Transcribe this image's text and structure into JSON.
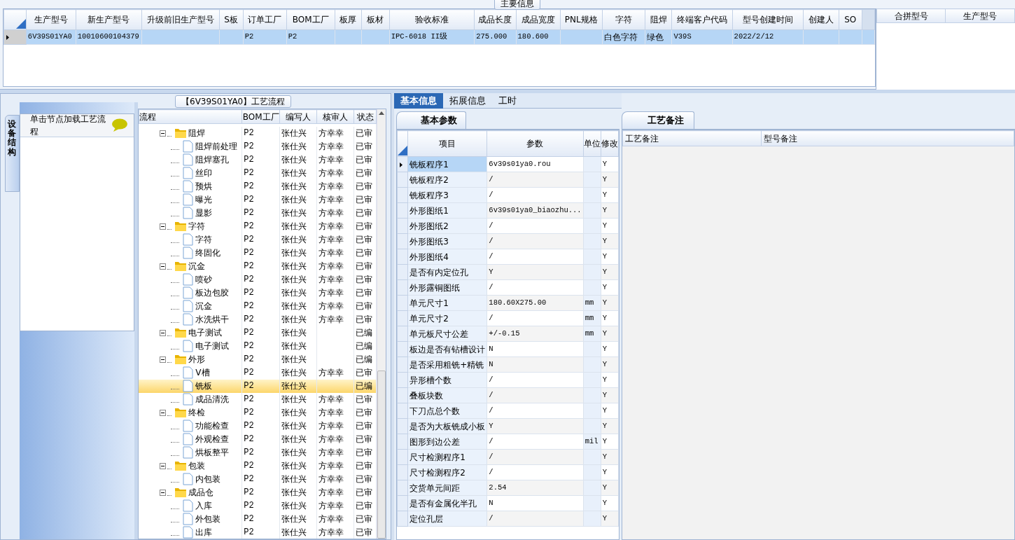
{
  "main_info": {
    "title": "主要信息",
    "columns": [
      "生产型号",
      "新生产型号",
      "升级前旧生产型号",
      "S板",
      "订单工厂",
      "BOM工厂",
      "板厚",
      "板材",
      "验收标准",
      "成品长度",
      "成品宽度",
      "PNL规格",
      "字符",
      "阻焊",
      "终端客户代码",
      "型号创建时间",
      "创建人",
      "SO"
    ],
    "rows": [
      {
        "selected": true,
        "cells": [
          "6V39S01YA0",
          "10010600104379",
          null,
          null,
          "P2",
          "P2",
          null,
          null,
          "IPC-6018 II级",
          "275.000",
          "180.600",
          null,
          "白色字符",
          "绿色",
          "V39S",
          "2022/2/12",
          null,
          null
        ]
      }
    ]
  },
  "merge_grid": {
    "columns": [
      "合拼型号",
      "生产型号"
    ]
  },
  "process_panel": {
    "title": "【6V39S01YA0】工艺流程",
    "side_tab": "设备结构",
    "hint": "单击节点加载工艺流程"
  },
  "tree": {
    "columns": [
      "流程",
      "BOM工厂",
      "编写人",
      "核审人",
      "状态"
    ],
    "nodes": [
      {
        "label": "阻焊",
        "bom": "P2",
        "author": "张仕兴",
        "reviewer": "方幸幸",
        "status": "已审",
        "expanded": true,
        "selected": false,
        "children": [
          {
            "label": "阻焊前处理",
            "bom": "P2",
            "author": "张仕兴",
            "reviewer": "方幸幸",
            "status": "已审",
            "selected": false
          },
          {
            "label": "阻焊塞孔",
            "bom": "P2",
            "author": "张仕兴",
            "reviewer": "方幸幸",
            "status": "已审",
            "selected": false
          },
          {
            "label": "丝印",
            "bom": "P2",
            "author": "张仕兴",
            "reviewer": "方幸幸",
            "status": "已审",
            "selected": false
          },
          {
            "label": "预烘",
            "bom": "P2",
            "author": "张仕兴",
            "reviewer": "方幸幸",
            "status": "已审",
            "selected": false
          },
          {
            "label": "曝光",
            "bom": "P2",
            "author": "张仕兴",
            "reviewer": "方幸幸",
            "status": "已审",
            "selected": false
          },
          {
            "label": "显影",
            "bom": "P2",
            "author": "张仕兴",
            "reviewer": "方幸幸",
            "status": "已审",
            "selected": false
          }
        ]
      },
      {
        "label": "字符",
        "bom": "P2",
        "author": "张仕兴",
        "reviewer": "方幸幸",
        "status": "已审",
        "expanded": true,
        "selected": false,
        "children": [
          {
            "label": "字符",
            "bom": "P2",
            "author": "张仕兴",
            "reviewer": "方幸幸",
            "status": "已审",
            "selected": false
          },
          {
            "label": "终固化",
            "bom": "P2",
            "author": "张仕兴",
            "reviewer": "方幸幸",
            "status": "已审",
            "selected": false
          }
        ]
      },
      {
        "label": "沉金",
        "bom": "P2",
        "author": "张仕兴",
        "reviewer": "方幸幸",
        "status": "已审",
        "expanded": true,
        "selected": false,
        "children": [
          {
            "label": "喷砂",
            "bom": "P2",
            "author": "张仕兴",
            "reviewer": "方幸幸",
            "status": "已审",
            "selected": false
          },
          {
            "label": "板边包胶",
            "bom": "P2",
            "author": "张仕兴",
            "reviewer": "方幸幸",
            "status": "已审",
            "selected": false
          },
          {
            "label": "沉金",
            "bom": "P2",
            "author": "张仕兴",
            "reviewer": "方幸幸",
            "status": "已审",
            "selected": false
          },
          {
            "label": "水洗烘干",
            "bom": "P2",
            "author": "张仕兴",
            "reviewer": "方幸幸",
            "status": "已审",
            "selected": false
          }
        ]
      },
      {
        "label": "电子测试",
        "bom": "P2",
        "author": "张仕兴",
        "status": "已编",
        "expanded": true,
        "selected": false,
        "children": [
          {
            "label": "电子测试",
            "bom": "P2",
            "author": "张仕兴",
            "status": "已编",
            "selected": false
          }
        ]
      },
      {
        "label": "外形",
        "bom": "P2",
        "author": "张仕兴",
        "status": "已编",
        "expanded": true,
        "selected": false,
        "children": [
          {
            "label": "V槽",
            "bom": "P2",
            "author": "张仕兴",
            "reviewer": "方幸幸",
            "status": "已审",
            "selected": false
          },
          {
            "label": "铣板",
            "bom": "P2",
            "author": "张仕兴",
            "status": "已编",
            "selected": true
          },
          {
            "label": "成品清洗",
            "bom": "P2",
            "author": "张仕兴",
            "reviewer": "方幸幸",
            "status": "已审",
            "selected": false
          }
        ]
      },
      {
        "label": "终检",
        "bom": "P2",
        "author": "张仕兴",
        "reviewer": "方幸幸",
        "status": "已审",
        "expanded": true,
        "selected": false,
        "children": [
          {
            "label": "功能检查",
            "bom": "P2",
            "author": "张仕兴",
            "reviewer": "方幸幸",
            "status": "已审",
            "selected": false
          },
          {
            "label": "外观检查",
            "bom": "P2",
            "author": "张仕兴",
            "reviewer": "方幸幸",
            "status": "已审",
            "selected": false
          },
          {
            "label": "烘板整平",
            "bom": "P2",
            "author": "张仕兴",
            "reviewer": "方幸幸",
            "status": "已审",
            "selected": false
          }
        ]
      },
      {
        "label": "包装",
        "bom": "P2",
        "author": "张仕兴",
        "reviewer": "方幸幸",
        "status": "已审",
        "expanded": true,
        "selected": false,
        "children": [
          {
            "label": "内包装",
            "bom": "P2",
            "author": "张仕兴",
            "reviewer": "方幸幸",
            "status": "已审",
            "selected": false
          }
        ]
      },
      {
        "label": "成品仓",
        "bom": "P2",
        "author": "张仕兴",
        "reviewer": "方幸幸",
        "status": "已审",
        "expanded": true,
        "selected": false,
        "children": [
          {
            "label": "入库",
            "bom": "P2",
            "author": "张仕兴",
            "reviewer": "方幸幸",
            "status": "已审",
            "selected": false
          },
          {
            "label": "外包装",
            "bom": "P2",
            "author": "张仕兴",
            "reviewer": "方幸幸",
            "status": "已审",
            "selected": false
          },
          {
            "label": "出库",
            "bom": "P2",
            "author": "张仕兴",
            "reviewer": "方幸幸",
            "status": "已审",
            "selected": false
          }
        ]
      }
    ]
  },
  "detail_tabs": [
    {
      "label": "基本信息",
      "selected": true
    },
    {
      "label": "拓展信息",
      "selected": false
    },
    {
      "label": "工时",
      "selected": false
    }
  ],
  "params": {
    "tab": "基本参数",
    "columns": [
      "项目",
      "参数",
      "单位",
      "修改"
    ],
    "rows": [
      {
        "item": "铣板程序1",
        "value": "6v39s01ya0.rou",
        "modify": "Y",
        "selected": true
      },
      {
        "item": "铣板程序2",
        "value": "/",
        "modify": "Y",
        "selected": false
      },
      {
        "item": "铣板程序3",
        "value": "/",
        "modify": "Y",
        "selected": false
      },
      {
        "item": "外形图纸1",
        "value": "6v39s01ya0_biaozhu...",
        "modify": "Y",
        "selected": false
      },
      {
        "item": "外形图纸2",
        "value": "/",
        "modify": "Y",
        "selected": false
      },
      {
        "item": "外形图纸3",
        "value": "/",
        "modify": "Y",
        "selected": false
      },
      {
        "item": "外形图纸4",
        "value": "/",
        "modify": "Y",
        "selected": false
      },
      {
        "item": "是否有内定位孔",
        "value": "Y",
        "modify": "Y",
        "selected": false
      },
      {
        "item": "外形露铜图纸",
        "value": "/",
        "modify": "Y",
        "selected": false
      },
      {
        "item": "单元尺寸1",
        "value": "180.60X275.00",
        "unit": "mm",
        "modify": "Y",
        "selected": false
      },
      {
        "item": "单元尺寸2",
        "value": "/",
        "unit": "mm",
        "modify": "Y",
        "selected": false
      },
      {
        "item": "单元板尺寸公差",
        "value": "+/-0.15",
        "unit": "mm",
        "modify": "Y",
        "selected": false
      },
      {
        "item": "板边是否有钻槽设计",
        "value": "N",
        "modify": "Y",
        "selected": false
      },
      {
        "item": "是否采用粗铣+精铣",
        "value": "N",
        "modify": "Y",
        "selected": false
      },
      {
        "item": "异形槽个数",
        "value": "/",
        "modify": "Y",
        "selected": false
      },
      {
        "item": "叠板块数",
        "value": "/",
        "modify": "Y",
        "selected": false
      },
      {
        "item": "下刀点总个数",
        "value": "/",
        "modify": "Y",
        "selected": false
      },
      {
        "item": "是否为大板铣成小板",
        "value": "Y",
        "modify": "Y",
        "selected": false
      },
      {
        "item": "图形到边公差",
        "value": "/",
        "unit": "mil",
        "modify": "Y",
        "selected": false
      },
      {
        "item": "尺寸检测程序1",
        "value": "/",
        "modify": "Y",
        "selected": false
      },
      {
        "item": "尺寸检测程序2",
        "value": "/",
        "modify": "Y",
        "selected": false
      },
      {
        "item": "交货单元间距",
        "value": "2.54",
        "modify": "Y",
        "selected": false
      },
      {
        "item": "是否有金属化半孔",
        "value": "N",
        "modify": "Y",
        "selected": false
      },
      {
        "item": "定位孔层",
        "value": "/",
        "modify": "Y",
        "selected": false
      }
    ]
  },
  "notes": {
    "tab": "工艺备注",
    "columns": [
      "工艺备注",
      "型号备注"
    ]
  }
}
